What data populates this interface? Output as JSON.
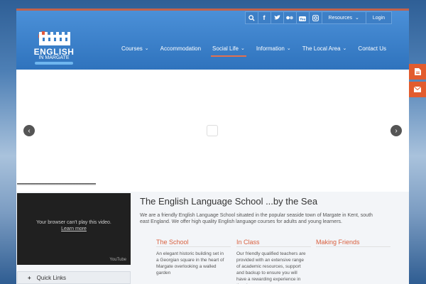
{
  "topbar": {
    "icons": [
      "search-icon",
      "facebook-icon",
      "twitter-icon",
      "flickr-icon",
      "youtube-icon",
      "instagram-icon"
    ],
    "resources_label": "Resources",
    "login_label": "Login"
  },
  "logo": {
    "line1": "ENGLISH",
    "line2": "IN MARGATE"
  },
  "nav": {
    "items": [
      {
        "label": "Courses",
        "has_dropdown": true
      },
      {
        "label": "Accommodation",
        "has_dropdown": false
      },
      {
        "label": "Social Life",
        "has_dropdown": true,
        "active": true
      },
      {
        "label": "Information",
        "has_dropdown": true
      },
      {
        "label": "The Local Area",
        "has_dropdown": true
      },
      {
        "label": "Contact Us",
        "has_dropdown": false
      }
    ]
  },
  "slider": {
    "prev_label": "‹",
    "next_label": "›"
  },
  "video": {
    "message": "Your browser can't play this video.",
    "link": "Learn more",
    "brand": "YouTube"
  },
  "quick_links": {
    "label": "Quick Links"
  },
  "main": {
    "title": "The English Language School ...by the Sea",
    "intro": "We are a friendly English Language School situated in the popular seaside town of Margate in Kent, south east England. We offer high quality English language courses for adults and young learners.",
    "columns": [
      {
        "title": "The School",
        "text": "An elegant historic building set in a Georgian square in the heart of Margate overlooking a walled garden"
      },
      {
        "title": "In Class",
        "text": "Our friendly qualified teachers are provided with an extensive range of academic resources, support and backup to ensure you will have a rewarding experience in the classroom"
      },
      {
        "title": "Making Friends",
        "text": ""
      }
    ]
  },
  "colors": {
    "header_blue": "#3a7fc8",
    "accent_orange": "#e25c2e",
    "heading_orange": "#d9603f"
  }
}
